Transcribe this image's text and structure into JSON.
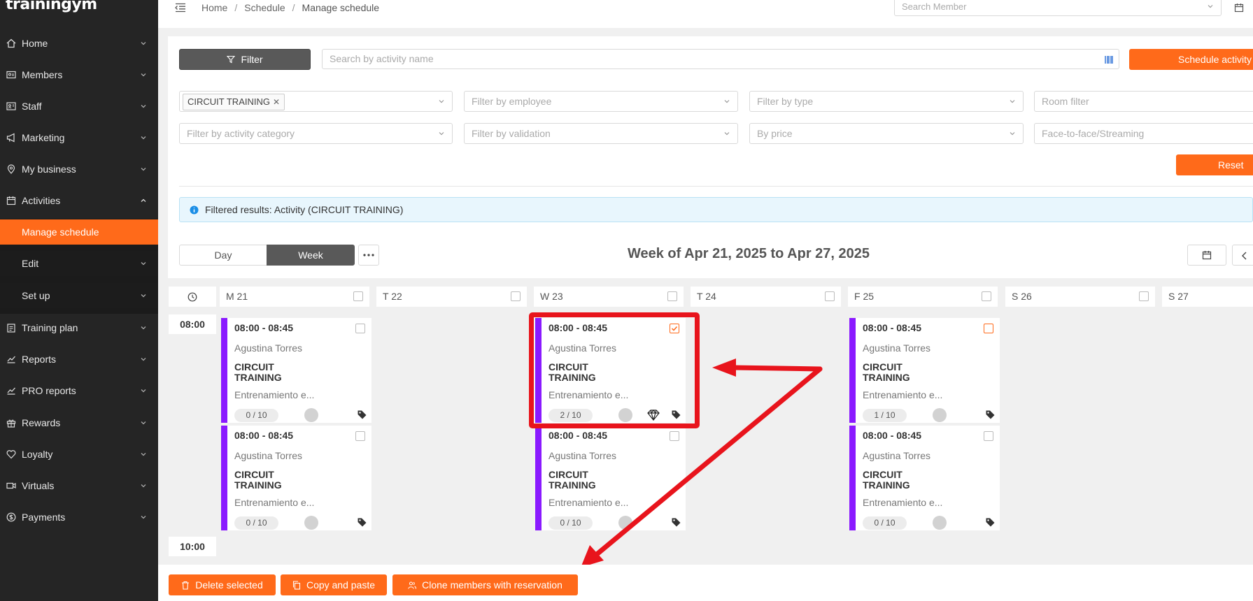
{
  "app": {
    "logo": "trainingym"
  },
  "sidebar": {
    "items": [
      {
        "label": "Home",
        "icon": "home-icon"
      },
      {
        "label": "Members",
        "icon": "id-card-icon"
      },
      {
        "label": "Staff",
        "icon": "badge-icon"
      },
      {
        "label": "Marketing",
        "icon": "megaphone-icon"
      },
      {
        "label": "My business",
        "icon": "location-pin-icon"
      },
      {
        "label": "Activities",
        "icon": "calendar-icon",
        "expanded": true
      },
      {
        "label": "Training plan",
        "icon": "clipboard-icon"
      },
      {
        "label": "Reports",
        "icon": "line-chart-icon"
      },
      {
        "label": "PRO reports",
        "icon": "line-chart-icon"
      },
      {
        "label": "Rewards",
        "icon": "gift-icon"
      },
      {
        "label": "Loyalty",
        "icon": "heart-icon"
      },
      {
        "label": "Virtuals",
        "icon": "video-icon"
      },
      {
        "label": "Payments",
        "icon": "dollar-circle-icon"
      }
    ],
    "subitems": [
      {
        "label": "Manage schedule",
        "active": true
      },
      {
        "label": "Edit"
      },
      {
        "label": "Set up"
      }
    ]
  },
  "topbar": {
    "breadcrumb": [
      "Home",
      "Schedule",
      "Manage schedule"
    ],
    "search_member_placeholder": "Search Member"
  },
  "toolbar": {
    "filter_label": "Filter",
    "activity_search_placeholder": "Search by activity name",
    "schedule_button": "Schedule activity"
  },
  "filters": {
    "activity_tag": "CIRCUIT TRAINING",
    "employee": "Filter by employee",
    "type": "Filter by type",
    "room": "Room filter",
    "activity_category": "Filter by activity category",
    "validation": "Filter by validation",
    "price": "By price",
    "mode": "Face-to-face/Streaming",
    "reset": "Reset"
  },
  "info": {
    "message": "Filtered results: Activity (CIRCUIT TRAINING)"
  },
  "view": {
    "day": "Day",
    "week": "Week",
    "selected": "Week"
  },
  "week_title": "Week of Apr 21, 2025 to Apr 27, 2025",
  "days": [
    "M 21",
    "T 22",
    "W 23",
    "T 24",
    "F 25",
    "S 26",
    "S 27"
  ],
  "times": [
    "08:00",
    "10:00"
  ],
  "cards": [
    {
      "time": "08:00 - 08:45",
      "instructor": "Agustina Torres",
      "name": "CIRCUIT TRAINING",
      "desc": "Entrenamiento e...",
      "capacity": "0 / 10",
      "checked": false
    },
    {
      "time": "08:00 - 08:45",
      "instructor": "Agustina Torres",
      "name": "CIRCUIT TRAINING",
      "desc": "Entrenamiento e...",
      "capacity": "0 / 10",
      "checked": false
    },
    {
      "time": "08:00 - 08:45",
      "instructor": "Agustina Torres",
      "name": "CIRCUIT TRAINING",
      "desc": "Entrenamiento e...",
      "capacity": "2 / 10",
      "checked": true
    },
    {
      "time": "08:00 - 08:45",
      "instructor": "Agustina Torres",
      "name": "CIRCUIT TRAINING",
      "desc": "Entrenamiento e...",
      "capacity": "0 / 10",
      "checked": false
    },
    {
      "time": "08:00 - 08:45",
      "instructor": "Agustina Torres",
      "name": "CIRCUIT TRAINING",
      "desc": "Entrenamiento e...",
      "capacity": "1 / 10",
      "checked": false
    },
    {
      "time": "08:00 - 08:45",
      "instructor": "Agustina Torres",
      "name": "CIRCUIT TRAINING",
      "desc": "Entrenamiento e...",
      "capacity": "0 / 10",
      "checked": false
    }
  ],
  "bottom": {
    "delete": "Delete selected",
    "copy": "Copy and paste",
    "clone": "Clone members with reservation"
  },
  "colors": {
    "accent": "#ff6a1a",
    "activity": "#8a1aff",
    "annotation": "#e8141c",
    "sidebar": "#252525"
  }
}
